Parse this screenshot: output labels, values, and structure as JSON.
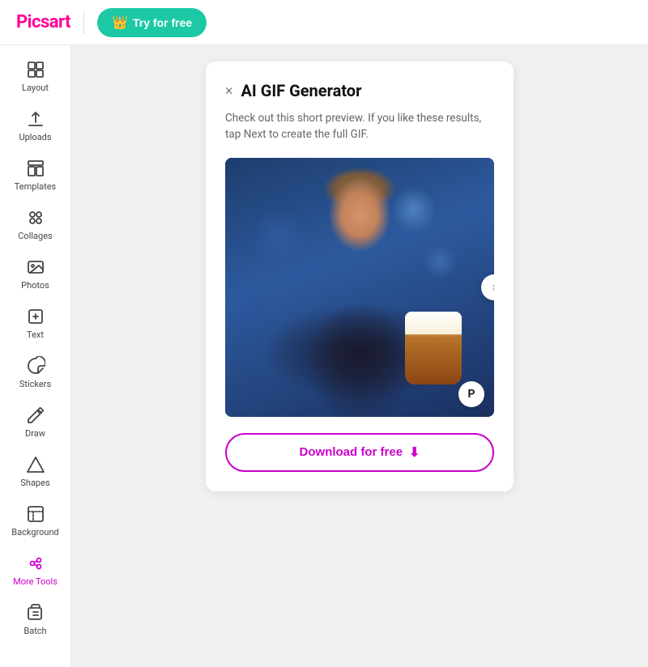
{
  "header": {
    "logo": "Picsart",
    "divider": true,
    "try_button_label": "Try for free",
    "try_button_icon": "👑"
  },
  "sidebar": {
    "items": [
      {
        "id": "layout",
        "label": "Layout",
        "icon": "layout"
      },
      {
        "id": "uploads",
        "label": "Uploads",
        "icon": "uploads"
      },
      {
        "id": "templates",
        "label": "Templates",
        "icon": "templates"
      },
      {
        "id": "collages",
        "label": "Collages",
        "icon": "collages"
      },
      {
        "id": "photos",
        "label": "Photos",
        "icon": "photos"
      },
      {
        "id": "text",
        "label": "Text",
        "icon": "text"
      },
      {
        "id": "stickers",
        "label": "Stickers",
        "icon": "stickers"
      },
      {
        "id": "draw",
        "label": "Draw",
        "icon": "draw"
      },
      {
        "id": "shapes",
        "label": "Shapes",
        "icon": "shapes"
      },
      {
        "id": "background",
        "label": "Background",
        "icon": "background"
      },
      {
        "id": "more-tools",
        "label": "More Tools",
        "icon": "more-tools",
        "active": true
      },
      {
        "id": "batch",
        "label": "Batch",
        "icon": "batch"
      }
    ]
  },
  "panel": {
    "title": "AI GIF Generator",
    "close_label": "×",
    "description": "Check out this short preview. If you like these results, tap Next to create the full GIF.",
    "picsart_badge": "P",
    "download_button_label": "Download for free",
    "download_icon": "⬇"
  }
}
